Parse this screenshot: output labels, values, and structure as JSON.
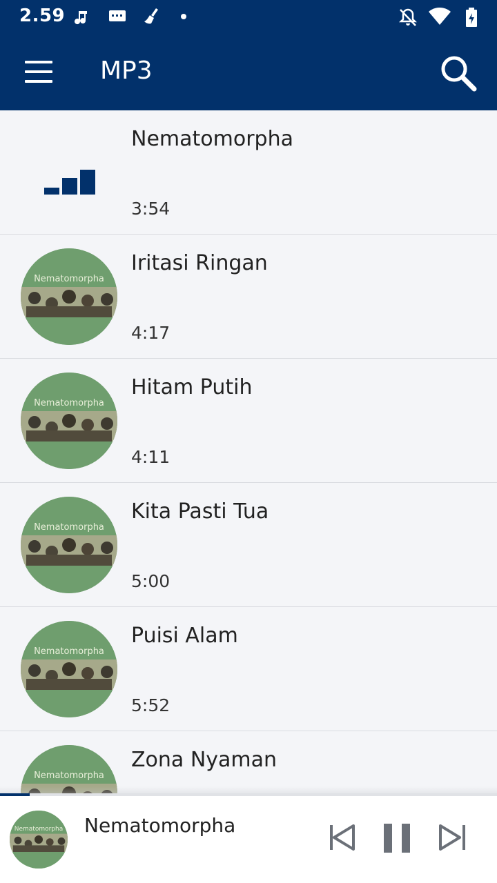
{
  "status_bar": {
    "time": "2.59",
    "icons": [
      "music-note-icon",
      "message-icon",
      "broom-icon",
      "dot-icon",
      "notifications-off-icon",
      "wifi-icon",
      "battery-charging-icon"
    ]
  },
  "app_bar": {
    "title": "MP3",
    "menu_icon": "hamburger-menu-icon",
    "search_icon": "search-icon"
  },
  "album_art_text": "Nematomorpha",
  "songs": [
    {
      "title": "Nematomorpha",
      "duration": "3:54",
      "playing": true
    },
    {
      "title": "Iritasi Ringan",
      "duration": "4:17",
      "playing": false
    },
    {
      "title": "Hitam Putih",
      "duration": "4:11",
      "playing": false
    },
    {
      "title": "Kita Pasti Tua",
      "duration": "5:00",
      "playing": false
    },
    {
      "title": "Puisi Alam",
      "duration": "5:52",
      "playing": false
    },
    {
      "title": "Zona Nyaman",
      "duration": "",
      "playing": false
    }
  ],
  "now_playing": {
    "title": "Nematomorpha",
    "progress_fraction": 0.06,
    "controls": [
      "skip-previous-icon",
      "pause-icon",
      "skip-next-icon"
    ]
  },
  "colors": {
    "primary": "#02316b",
    "list_background": "#f4f5f8",
    "album_green": "#6f9e6e"
  }
}
